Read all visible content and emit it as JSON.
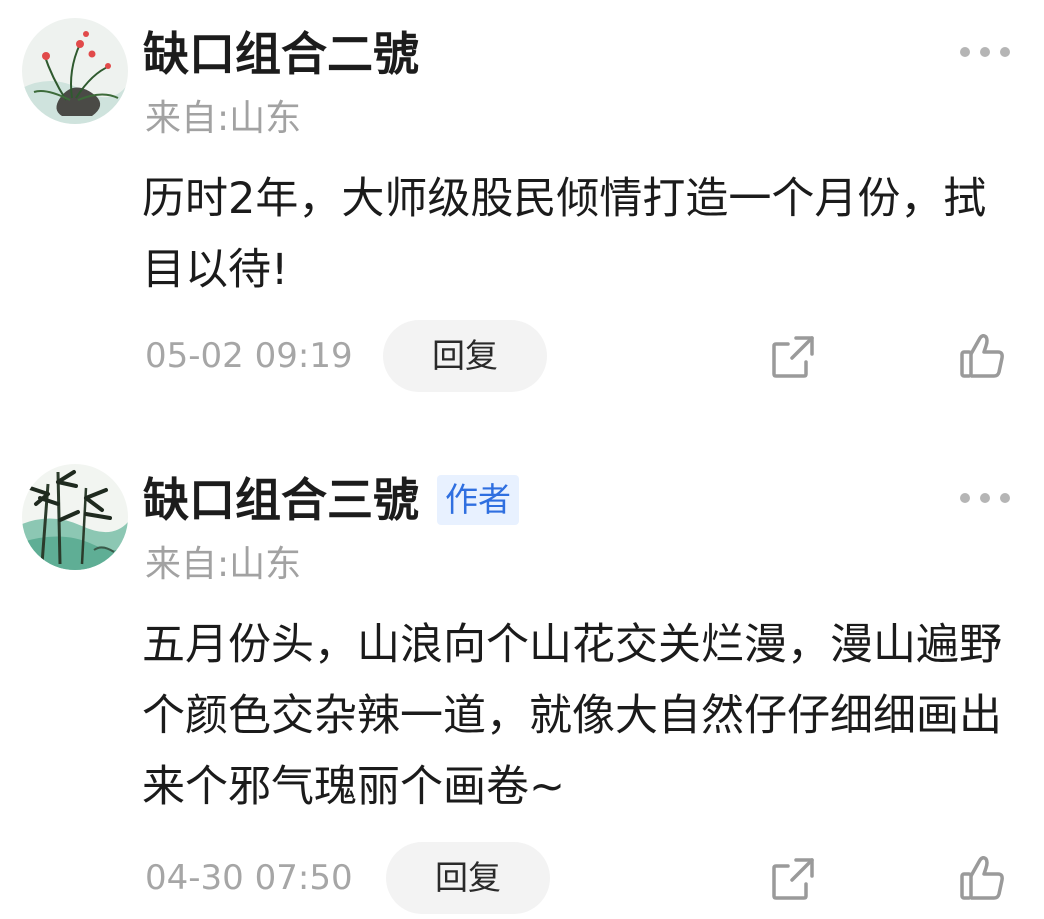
{
  "comments": [
    {
      "username": "缺口组合二號",
      "badge": "",
      "location": "来自:山东",
      "content": "历时2年，大师级股民倾情打造一个月份，拭目以待!",
      "time": "05-02 09:19",
      "reply_label": "回复",
      "avatar_icon": "orchid-painting-avatar"
    },
    {
      "username": "缺口组合三號",
      "badge": "作者",
      "location": "来自:山东",
      "content": "五月份头，山浪向个山花交关烂漫，漫山遍野个颜色交杂辣一道，就像大自然仔仔细细画出来个邪气瑰丽个画卷~",
      "time": "04-30 07:50",
      "reply_label": "回复",
      "avatar_icon": "bamboo-landscape-avatar"
    }
  ],
  "colors": {
    "badge_bg": "#e8f1ff",
    "badge_text": "#2f6fe0",
    "muted_text": "#a2a2a2",
    "reply_bg": "#f3f3f3"
  }
}
